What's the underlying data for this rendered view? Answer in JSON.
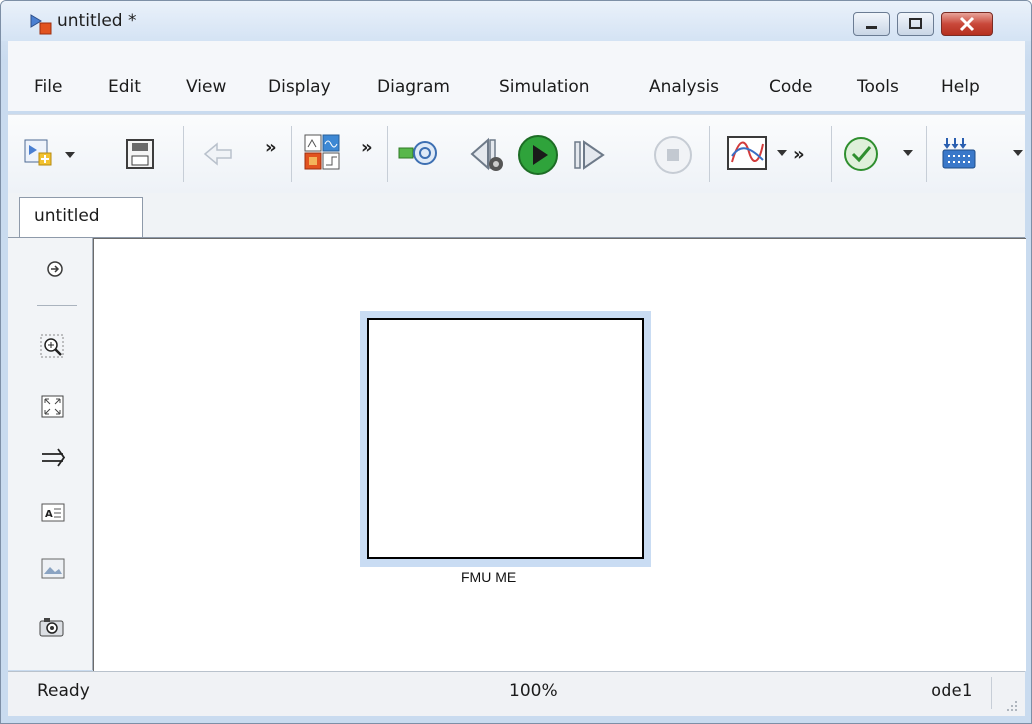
{
  "window": {
    "title": "untitled *",
    "app_icon": "simulink-model-icon",
    "controls": [
      "minimize-icon",
      "maximize-icon",
      "close-icon"
    ]
  },
  "menu": {
    "items": [
      {
        "label": "File"
      },
      {
        "label": "Edit"
      },
      {
        "label": "View"
      },
      {
        "label": "Display"
      },
      {
        "label": "Diagram"
      },
      {
        "label": "Simulation"
      },
      {
        "label": "Analysis"
      },
      {
        "label": "Code"
      },
      {
        "label": "Tools"
      },
      {
        "label": "Help"
      }
    ]
  },
  "toolbar": {
    "overflow_glyph": "»",
    "buttons": [
      "new-model-icon",
      "save-icon",
      "back-arrow-icon",
      "library-browser-icon",
      "model-configuration-icon",
      "step-back-icon",
      "run-icon",
      "step-forward-icon",
      "stop-icon",
      "scope-icon",
      "model-advisor-icon",
      "build-icon"
    ]
  },
  "tabs": [
    {
      "label": "untitled"
    }
  ],
  "palette": {
    "tools": [
      "navigate-icon",
      "zoom-icon",
      "fit-to-view-icon",
      "arrow-icon",
      "annotation-icon",
      "image-icon",
      "camera-icon"
    ]
  },
  "canvas": {
    "block": {
      "label": "FMU ME",
      "selected": true
    }
  },
  "status": {
    "left": "Ready",
    "zoom": "100%",
    "solver": "ode1"
  },
  "colors": {
    "selection": "#c9dcf3",
    "run_green": "#2fa33b",
    "close_red": "#c9483a"
  }
}
